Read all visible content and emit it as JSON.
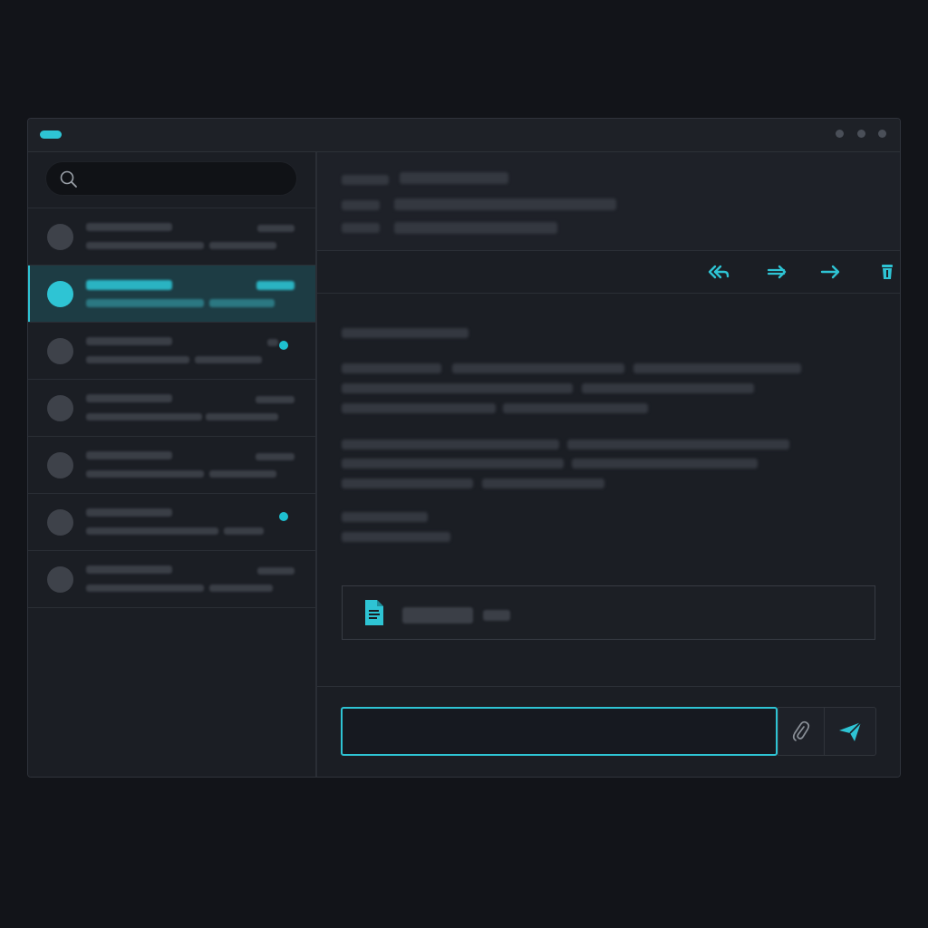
{
  "search": {
    "placeholder": ""
  },
  "reply": {
    "placeholder": ""
  },
  "message_list": {
    "items": [
      {
        "selected": false,
        "unread": false
      },
      {
        "selected": true,
        "unread": false
      },
      {
        "selected": false,
        "unread": true
      },
      {
        "selected": false,
        "unread": false
      },
      {
        "selected": false,
        "unread": false
      },
      {
        "selected": false,
        "unread": true
      },
      {
        "selected": false,
        "unread": false
      }
    ]
  },
  "toolbar": {
    "icons": [
      "reply-all-icon",
      "reply-icon",
      "forward-icon",
      "trash-icon"
    ]
  },
  "colors": {
    "accent": "#2ec4d4",
    "background": "#121419",
    "panel": "#1b1e24",
    "selected_row": "#1d3c44"
  }
}
